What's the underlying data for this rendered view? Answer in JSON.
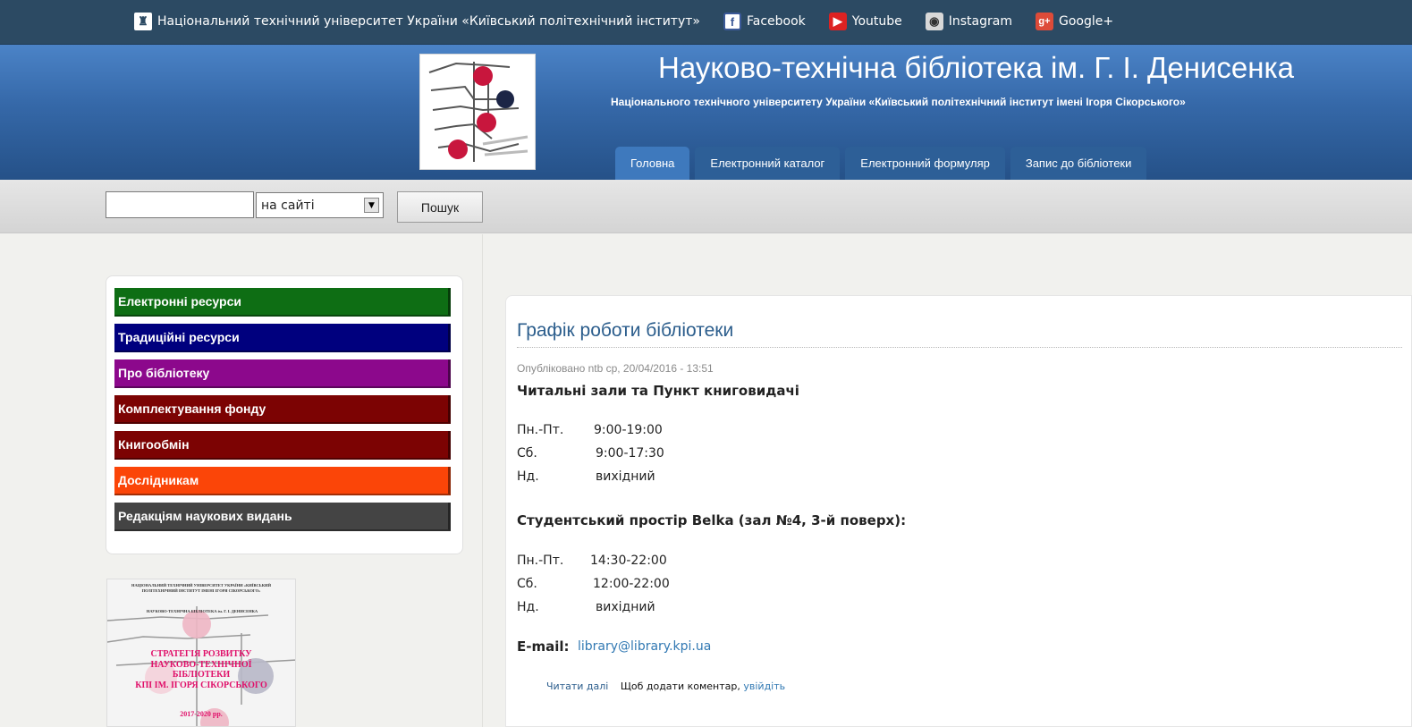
{
  "topbar": {
    "university": "Національний технічний університет України «Київський політехнічний інститут»",
    "links": [
      "Facebook",
      "Youtube",
      "Instagram",
      "Google+"
    ]
  },
  "header": {
    "site_name": "Науково-технічна бібліотека ім. Г. І. Денисенка",
    "slogan": "Національного технічного університету України «Київський політехнічний інститут імені Ігоря Сікорського»",
    "tabs": [
      "Головна",
      "Електронний каталог",
      "Електронний формуляр",
      "Запис до бібліотеки"
    ],
    "active_tab": "Головна"
  },
  "search": {
    "input_value": "",
    "scope_selected": "на сайті",
    "button": "Пошук"
  },
  "sidebar": {
    "menu": [
      {
        "label": "Електронні ресурси",
        "color": "#0e6e14"
      },
      {
        "label": "Традиційні ресурси",
        "color": "#00007e"
      },
      {
        "label": "Про бібліотеку",
        "color": "#8c088c"
      },
      {
        "label": "Комплектування фонду",
        "color": "#7c0303"
      },
      {
        "label": "Книгообмін",
        "color": "#7c0303"
      },
      {
        "label": "Дослідникам",
        "color": "#fb4508"
      },
      {
        "label": "Редакціям наукових видань",
        "color": "#444444"
      }
    ],
    "cover": {
      "head": "НАЦІОНАЛЬНИЙ ТЕХНІЧНИЙ УНІВЕРСИТЕТ УКРАЇНИ «КИЇВСЬКИЙ ПОЛІТЕХНІЧНИЙ ІНСТИТУТ ІМЕНІ ІГОРЯ СІКОРСЬКОГО»",
      "library": "НАУКОВО-ТЕХНІЧНА БІБЛІОТЕКА ім. Г. І. ДЕНИСЕНКА",
      "title_lines": [
        "СТРАТЕГІЯ РОЗВИТКУ",
        "НАУКОВО-ТЕХНІЧНОЇ",
        "БІБЛІОТЕКИ",
        "КПІ ІМ. ІГОРЯ СІКОРСЬКОГО"
      ],
      "years": "2017-2020 рр."
    }
  },
  "article": {
    "title": "Графік роботи бібліотеки",
    "submitted": "Опубліковано ntb ср, 20/04/2016 - 13:51",
    "section1_heading": "Читальні зали та Пункт книговидачі",
    "section1_rows": [
      {
        "day": "Пн.-Пт.",
        "time": "9:00-19:00"
      },
      {
        "day": "Сб.",
        "time": "9:00-17:30"
      },
      {
        "day": "Нд.",
        "time": "вихідний"
      }
    ],
    "section2_heading": "Студентський простір Belka (зал №4, 3-й поверх):",
    "section2_rows": [
      {
        "day": "Пн.-Пт.",
        "time": "14:30-22:00"
      },
      {
        "day": "Сб.",
        "time": "12:00-22:00"
      },
      {
        "day": "Нд.",
        "time": "вихідний"
      }
    ],
    "email_label": "E-mail:",
    "email": "library@library.kpi.ua",
    "read_more": "Читати далі",
    "comment_prompt": "Щоб додати коментар,",
    "login_link": "увійдіть"
  }
}
